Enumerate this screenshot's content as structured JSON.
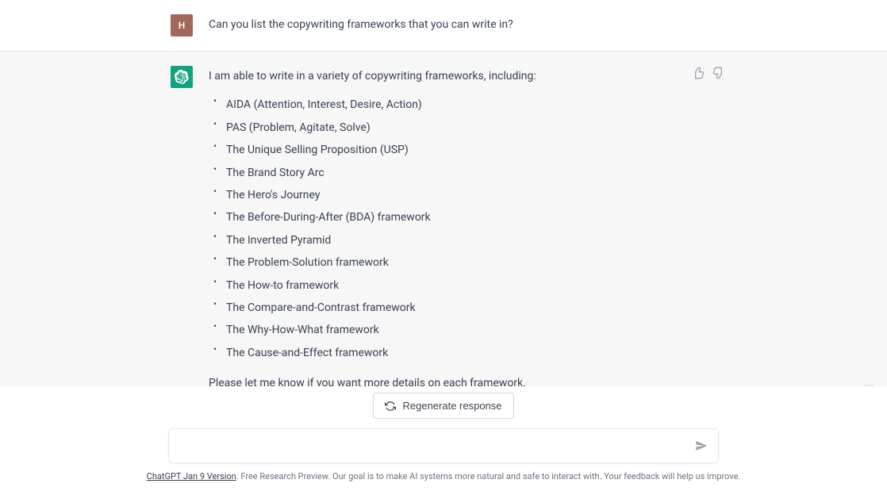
{
  "user": {
    "avatar_letter": "H",
    "message": "Can you list the copywriting frameworks that you can write in?"
  },
  "assistant": {
    "intro": "I am able to write in a variety of copywriting frameworks, including:",
    "items": [
      "AIDA (Attention, Interest, Desire, Action)",
      "PAS (Problem, Agitate, Solve)",
      "The Unique Selling Proposition (USP)",
      "The Brand Story Arc",
      "The Hero's Journey",
      "The Before-During-After (BDA) framework",
      "The Inverted Pyramid",
      "The Problem-Solution framework",
      "The How-to framework",
      "The Compare-and-Contrast framework",
      "The Why-How-What framework",
      "The Cause-and-Effect framework"
    ],
    "outro": "Please let me know if you want more details on each framework."
  },
  "controls": {
    "regenerate_label": "Regenerate response",
    "input_placeholder": ""
  },
  "footer": {
    "link_text": "ChatGPT Jan 9 Version",
    "rest": ". Free Research Preview. Our goal is to make AI systems more natural and safe to interact with. Your feedback will help us improve."
  }
}
